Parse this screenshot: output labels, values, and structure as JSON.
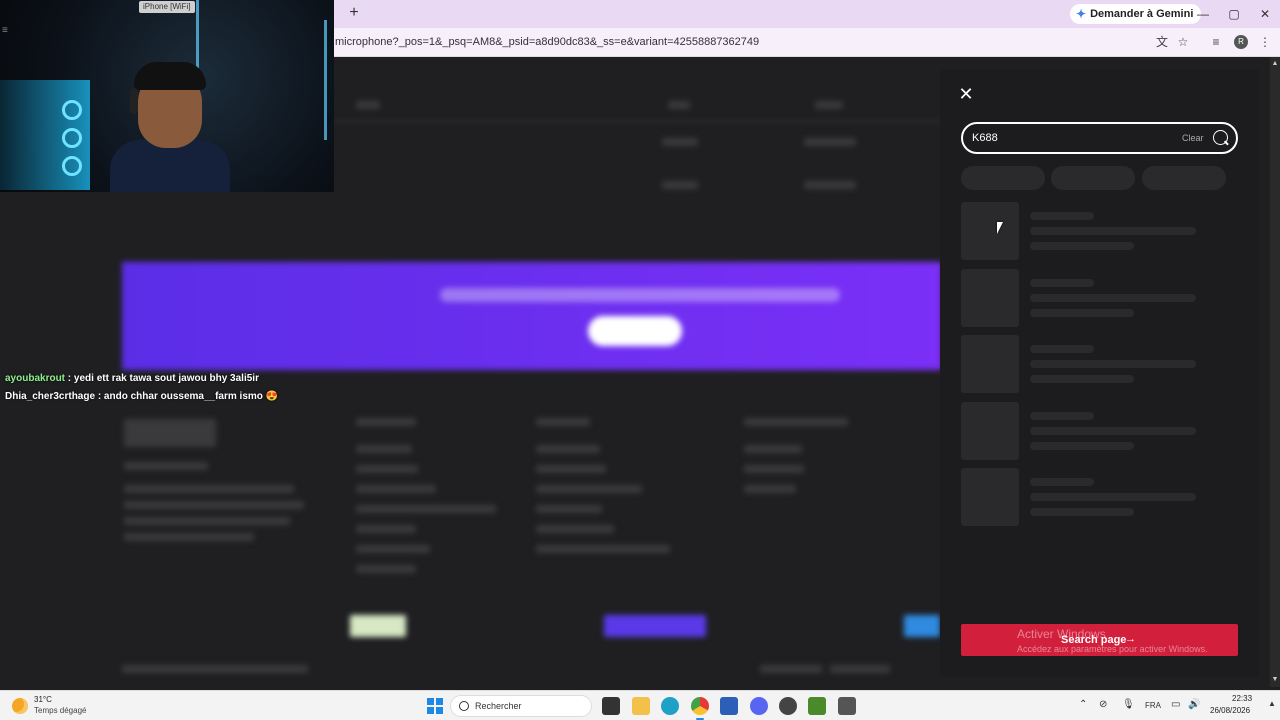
{
  "browser": {
    "new_tab_label": "+",
    "gemini_label": "Demander à Gemini",
    "url_text": "microphone?_pos=1&_psq=AM8&_psid=a8d90dc83&_ss=e&variant=42558887362749",
    "profile_initial": "R",
    "window_controls": {
      "minimize": "—",
      "maximize": "▢",
      "close": "✕"
    }
  },
  "webcam": {
    "device_label": "iPhone [WiFi]"
  },
  "chat": {
    "messages": [
      {
        "user": "ayoubakrout",
        "text": " : yedi ett rak tawa sout jawou bhy 3ali5ir"
      },
      {
        "user": "Dhia_cher3crthage",
        "text": " : ando chhar oussema__farm ismo 😍"
      }
    ]
  },
  "search_panel": {
    "query": "K688",
    "clear_label": "Clear",
    "search_page_label": "Search page",
    "arrow": "→"
  },
  "watermark": {
    "title": "Activer Windows",
    "subtitle": "Accédez aux paramètres pour activer Windows."
  },
  "taskbar": {
    "weather_temp": "31°C",
    "weather_desc": "Temps dégagé",
    "search_placeholder": "Rechercher",
    "language": "FRA",
    "time": "22:33",
    "date": "26/08/2026"
  },
  "colors": {
    "accent_red": "#d21f3c",
    "banner_purple": "#6a2ff0",
    "chat_user_green": "#8ef08e"
  }
}
